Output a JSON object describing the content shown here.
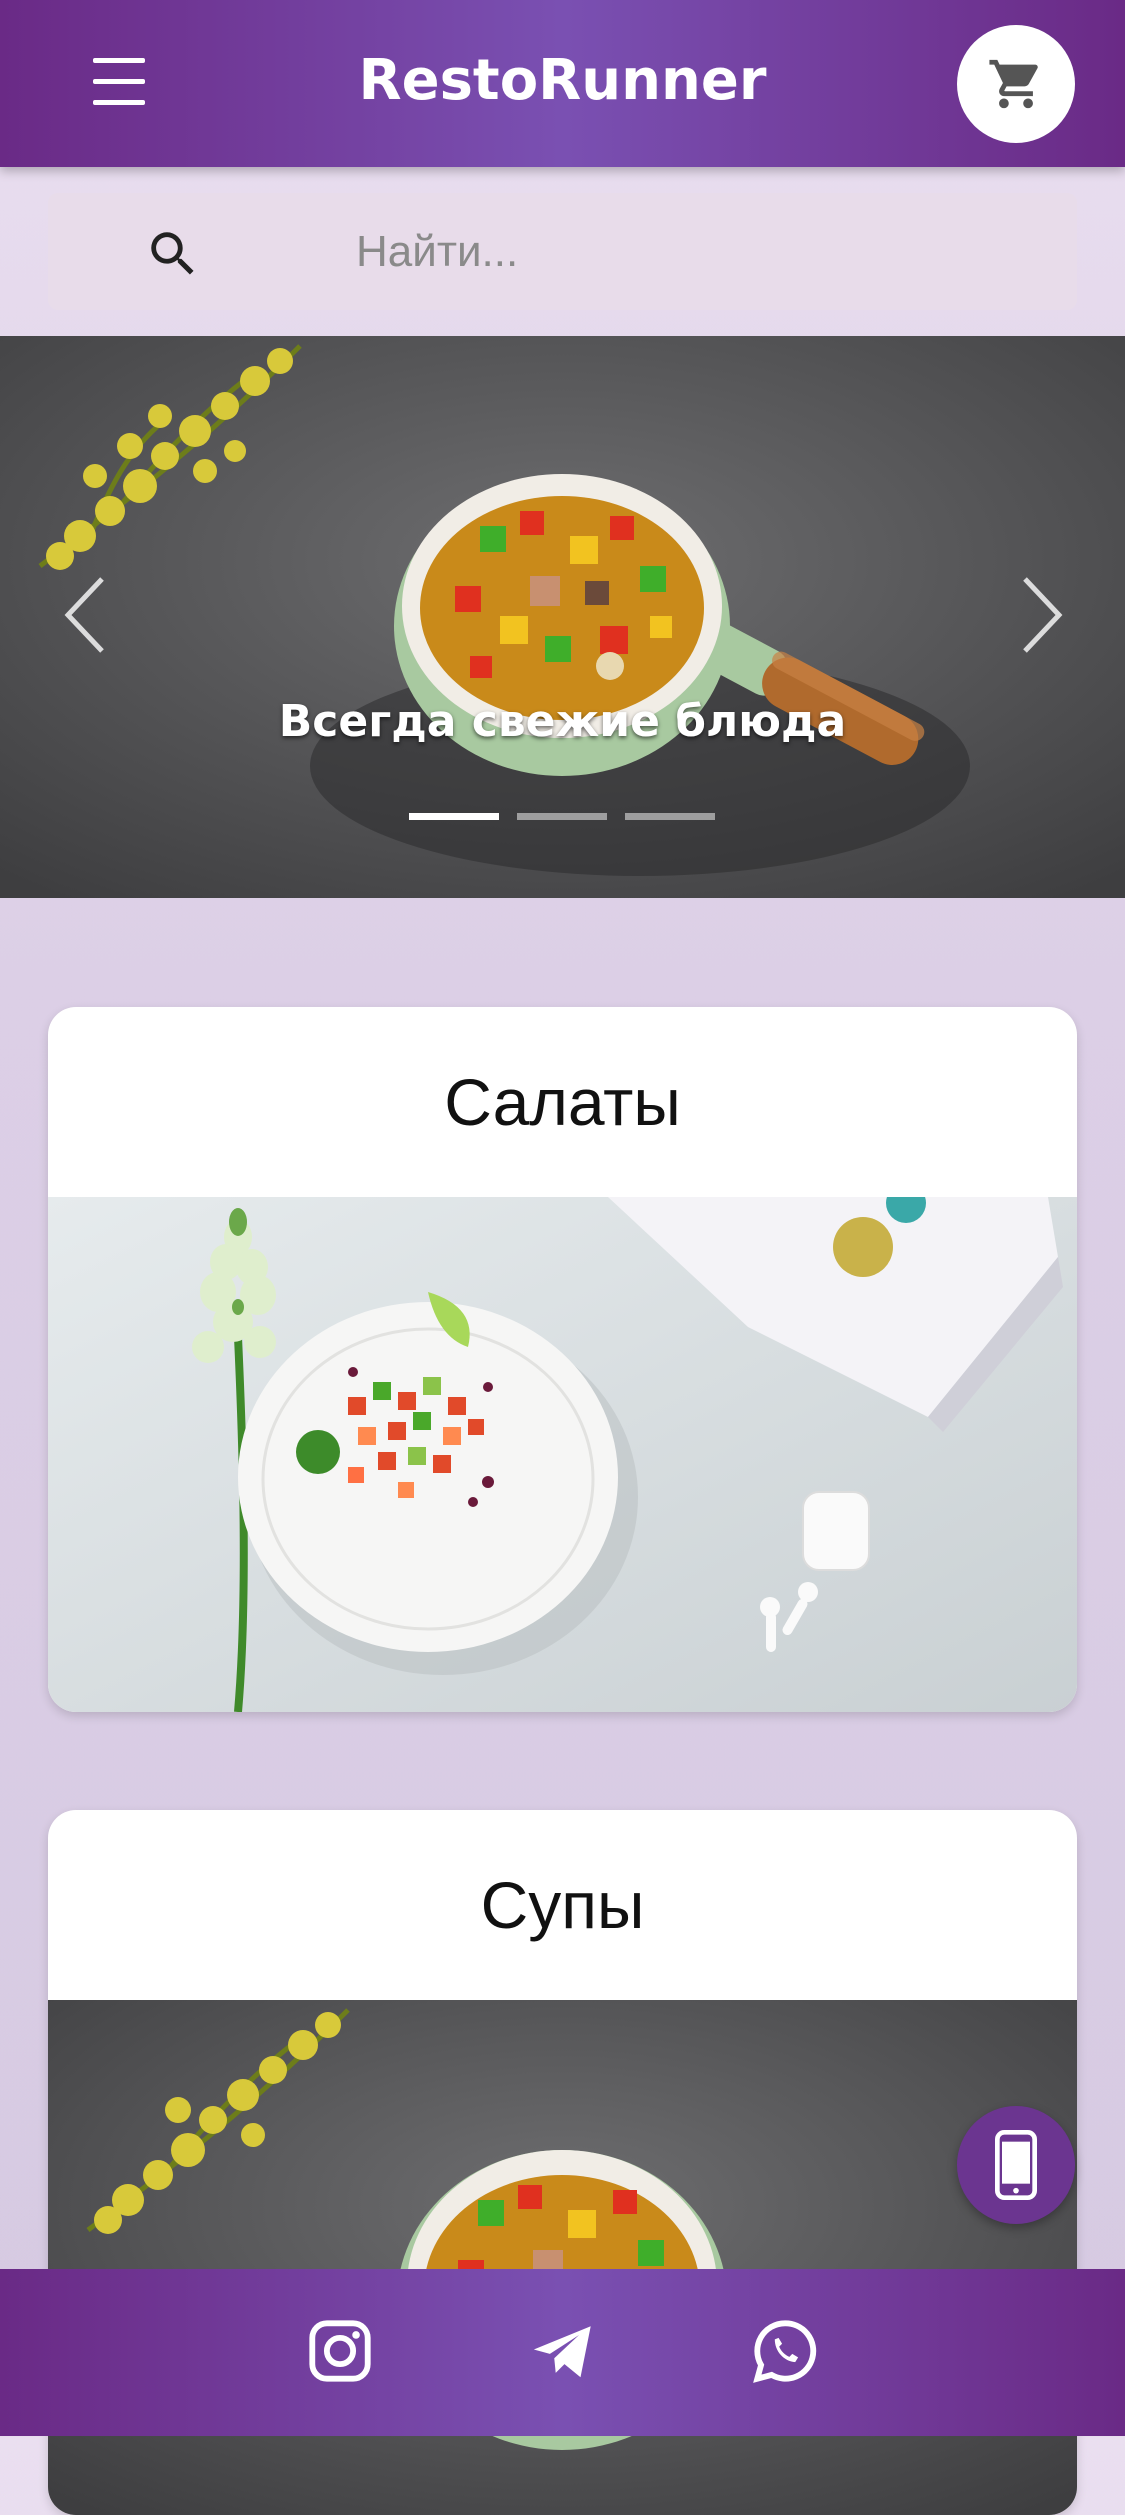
{
  "header": {
    "title": "RestoRunner",
    "menu_icon": "hamburger-menu-icon",
    "cart_icon": "shopping-cart-icon"
  },
  "search": {
    "placeholder": "Найти...",
    "icon": "search-icon"
  },
  "carousel": {
    "caption": "Всегда свежие блюда",
    "slide_count": 3,
    "active_index": 0,
    "prev_icon": "chevron-left-icon",
    "next_icon": "chevron-right-icon"
  },
  "categories": [
    {
      "title": "Салаты",
      "image": "salad-plate-image"
    },
    {
      "title": "Супы",
      "image": "soup-pot-image"
    }
  ],
  "fab": {
    "icon": "mobile-phone-icon"
  },
  "footer": {
    "social": [
      "instagram-icon",
      "telegram-icon",
      "whatsapp-icon"
    ]
  },
  "colors": {
    "primary": "#6a2a86",
    "primary_light": "#7a50b2",
    "background": "#e2d6ea",
    "search_bg": "#e8dcea",
    "fab": "#6b3590"
  }
}
